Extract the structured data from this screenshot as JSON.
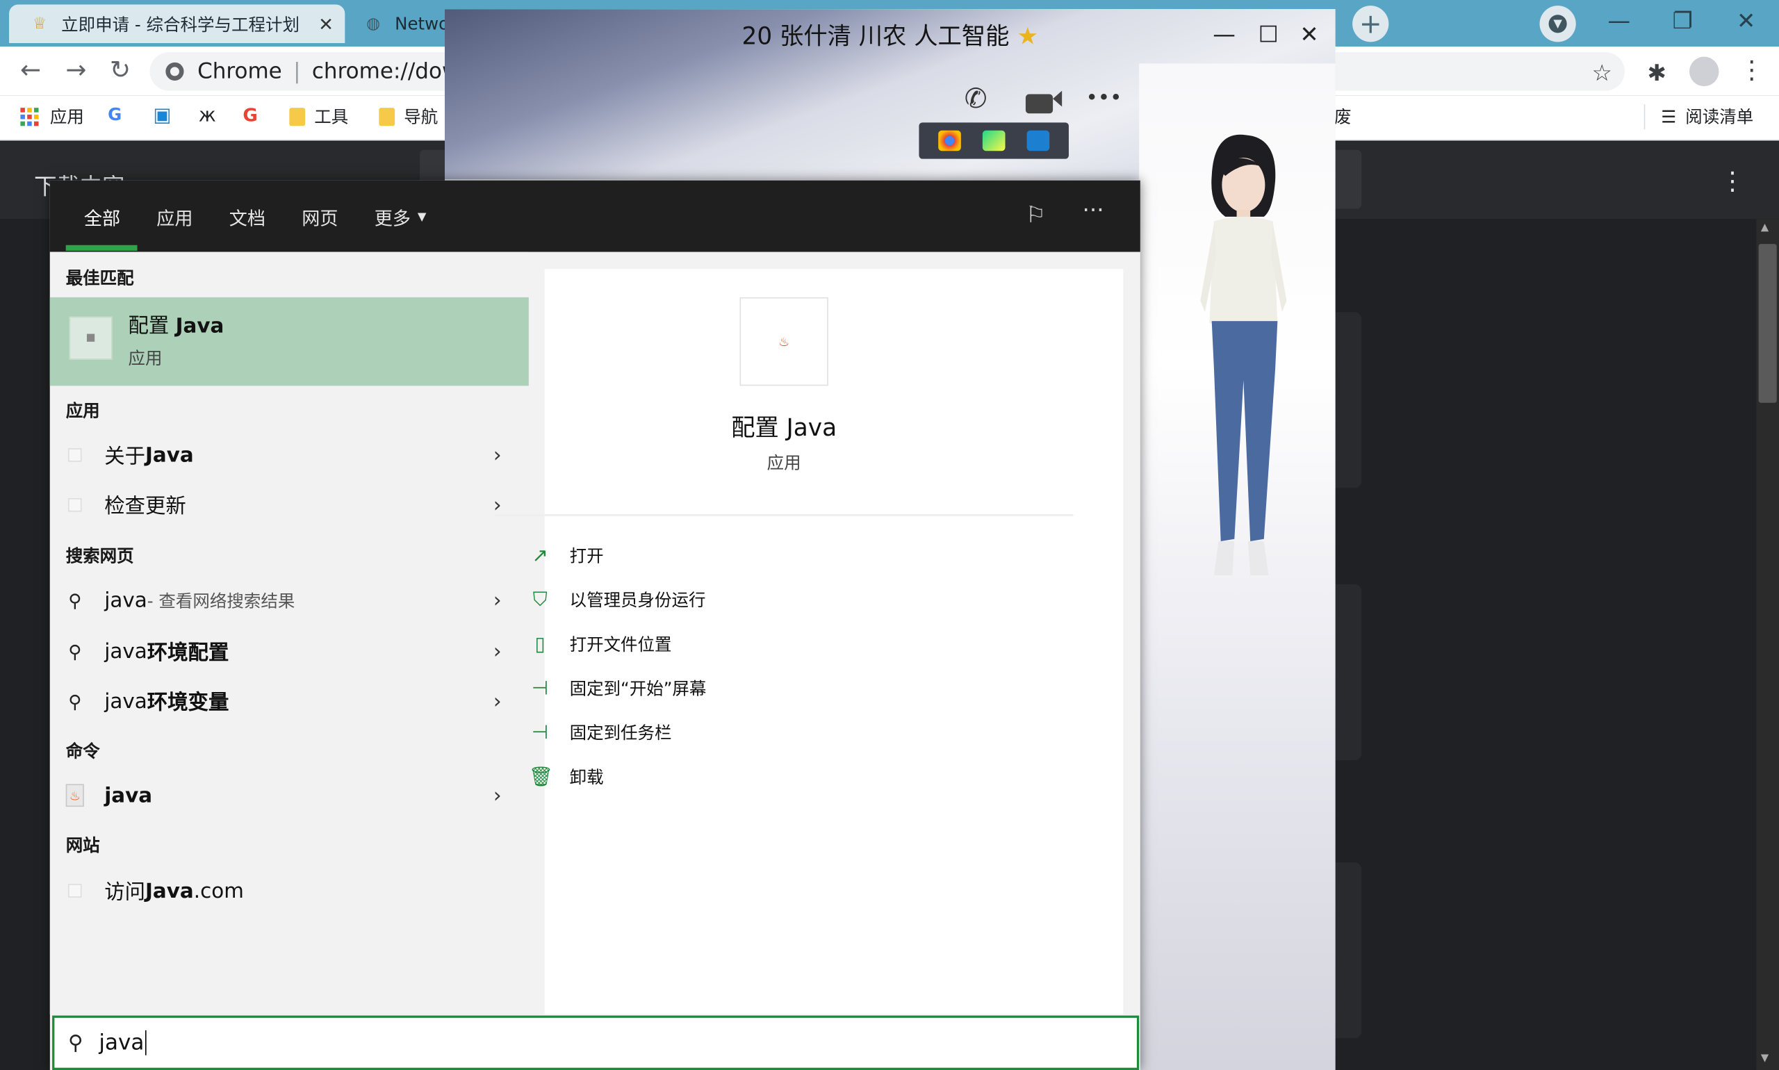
{
  "browser": {
    "tabs": [
      {
        "title": "立即申请 - 综合科学与工程计划",
        "close": "✕"
      },
      {
        "title": "Netwo"
      }
    ],
    "new_tab": "+",
    "window_controls": {
      "minimize": "—",
      "restore": "❐",
      "close": "✕"
    },
    "nav": {
      "back": "←",
      "forward": "→",
      "reload": "↻"
    },
    "omnibox": {
      "site": "Chrome",
      "url": "chrome://downl"
    },
    "bookmarks": [
      "应用",
      "工具",
      "导航"
    ],
    "bookmark_partial": "废",
    "reading_list": "阅读清单",
    "page_title": "下载内容"
  },
  "chat": {
    "title": "20 张什清 川农 人工智能",
    "star": "★",
    "controls": {
      "minimize": "—",
      "maximize": "☐",
      "close": "✕"
    },
    "more": "•••"
  },
  "search": {
    "tabs": [
      "全部",
      "应用",
      "文档",
      "网页",
      "更多"
    ],
    "more_caret": "▼",
    "more_options": "···",
    "sections": {
      "best_match": "最佳匹配",
      "apps": "应用",
      "web": "搜索网页",
      "commands": "命令",
      "sites": "网站"
    },
    "best": {
      "name_prefix": "配置 ",
      "name_bold": "Java",
      "type": "应用"
    },
    "apps": [
      {
        "prefix": "关于 ",
        "bold": "Java"
      },
      {
        "prefix": "检查更新",
        "bold": ""
      }
    ],
    "web": [
      {
        "prefix": "java",
        "bold": "",
        "hint": " - 查看网络搜索结果"
      },
      {
        "prefix": "java",
        "bold": "环境配置",
        "hint": ""
      },
      {
        "prefix": "java",
        "bold": "环境变量",
        "hint": ""
      }
    ],
    "commands": [
      {
        "prefix": "",
        "bold": "java"
      }
    ],
    "sites": [
      {
        "prefix": "访问 ",
        "bold": "Java",
        "suffix": ".com"
      }
    ],
    "detail": {
      "name": "配置 Java",
      "type": "应用"
    },
    "actions": [
      "打开",
      "以管理员身份运行",
      "打开文件位置",
      "固定到“开始”屏幕",
      "固定到任务栏",
      "卸载"
    ],
    "query": "java",
    "chevron": "›",
    "search_glyph": "⚲"
  },
  "colors": {
    "accent": "#1e8a3c",
    "selected": "#acd1b8",
    "tabstrip": "#58a5c5"
  }
}
